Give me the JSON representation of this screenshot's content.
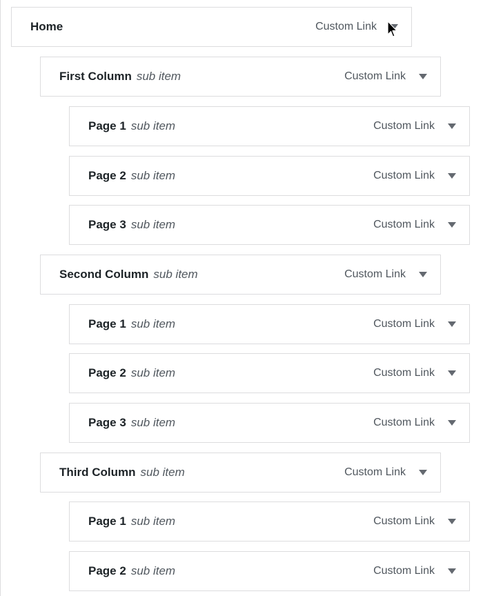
{
  "menu": {
    "items": [
      {
        "label": "Home",
        "sub": "",
        "type": "Custom Link"
      },
      {
        "label": "First Column",
        "sub": "sub item",
        "type": "Custom Link"
      },
      {
        "label": "Page 1",
        "sub": "sub item",
        "type": "Custom Link"
      },
      {
        "label": "Page 2",
        "sub": "sub item",
        "type": "Custom Link"
      },
      {
        "label": "Page 3",
        "sub": "sub item",
        "type": "Custom Link"
      },
      {
        "label": "Second Column",
        "sub": "sub item",
        "type": "Custom Link"
      },
      {
        "label": "Page 1",
        "sub": "sub item",
        "type": "Custom Link"
      },
      {
        "label": "Page 2",
        "sub": "sub item",
        "type": "Custom Link"
      },
      {
        "label": "Page 3",
        "sub": "sub item",
        "type": "Custom Link"
      },
      {
        "label": "Third Column",
        "sub": "sub item",
        "type": "Custom Link"
      },
      {
        "label": "Page 1",
        "sub": "sub item",
        "type": "Custom Link"
      },
      {
        "label": "Page 2",
        "sub": "sub item",
        "type": "Custom Link"
      }
    ]
  },
  "icons": {
    "toggle": "triangle-down-icon",
    "cursor": "mouse-pointer-icon"
  },
  "colors": {
    "border": "#dcdcde",
    "text": "#1d2327",
    "muted": "#50575e",
    "arrow": "#646970"
  }
}
